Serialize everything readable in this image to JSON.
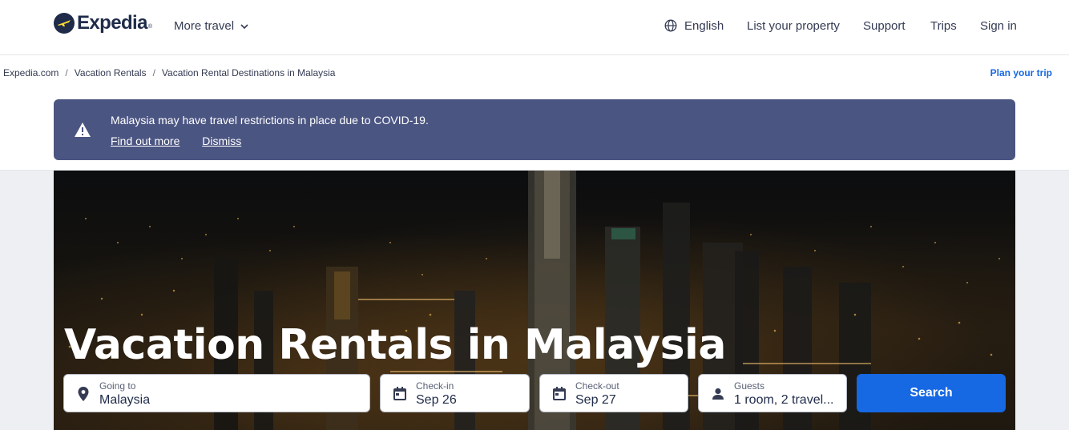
{
  "header": {
    "logo_text": "Expedia",
    "logo_tm": "®",
    "more_travel": "More travel",
    "language": "English",
    "list_property": "List your property",
    "support": "Support",
    "trips": "Trips",
    "sign_in": "Sign in"
  },
  "breadcrumb": {
    "items": [
      "Expedia.com",
      "Vacation Rentals",
      "Vacation Rental Destinations in Malaysia"
    ],
    "separator": "/"
  },
  "plan_trip": "Plan your trip",
  "banner": {
    "message": "Malaysia may have travel restrictions in place due to COVID-19.",
    "find_out_more": "Find out more",
    "dismiss": "Dismiss"
  },
  "hero": {
    "title": "Vacation Rentals in Malaysia"
  },
  "search": {
    "going_to": {
      "label": "Going to",
      "value": "Malaysia"
    },
    "check_in": {
      "label": "Check-in",
      "value": "Sep 26"
    },
    "check_out": {
      "label": "Check-out",
      "value": "Sep 27"
    },
    "guests": {
      "label": "Guests",
      "value": "1 room, 2 travel..."
    },
    "button": "Search"
  },
  "colors": {
    "brand_navy": "#1f2b49",
    "brand_blue": "#1668e3",
    "banner_bg": "#4b5582",
    "logo_yellow": "#fddb32"
  },
  "icons": {
    "globe": "globe-icon",
    "warning": "warning-icon",
    "location": "location-pin-icon",
    "calendar": "calendar-icon",
    "person": "person-icon",
    "chevron": "chevron-down-icon"
  }
}
